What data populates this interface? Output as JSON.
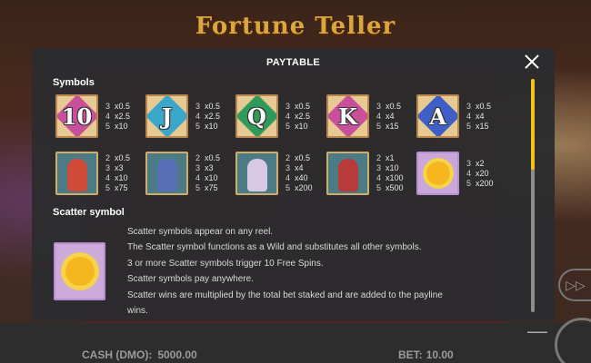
{
  "game": {
    "title": "Fortune Teller",
    "cash_label": "CASH (DMO):",
    "cash_value": "5000.00",
    "bet_label": "BET:",
    "bet_value": "10.00"
  },
  "paytable": {
    "title": "PAYTABLE",
    "close_icon": "close-icon",
    "symbols_heading": "Symbols",
    "symbols": [
      {
        "label": "10",
        "kind": "card",
        "color": "#c8509a",
        "pays": [
          [
            "3",
            "x0.5"
          ],
          [
            "4",
            "x2.5"
          ],
          [
            "5",
            "x10"
          ]
        ]
      },
      {
        "label": "J",
        "kind": "card",
        "color": "#3aa6c9",
        "pays": [
          [
            "3",
            "x0.5"
          ],
          [
            "4",
            "x2.5"
          ],
          [
            "5",
            "x10"
          ]
        ]
      },
      {
        "label": "Q",
        "kind": "card",
        "color": "#2f9a5a",
        "pays": [
          [
            "3",
            "x0.5"
          ],
          [
            "4",
            "x2.5"
          ],
          [
            "5",
            "x10"
          ]
        ]
      },
      {
        "label": "K",
        "kind": "card",
        "color": "#c8509a",
        "pays": [
          [
            "3",
            "x0.5"
          ],
          [
            "4",
            "x4"
          ],
          [
            "5",
            "x15"
          ]
        ]
      },
      {
        "label": "A",
        "kind": "card",
        "color": "#3f5fc7",
        "pays": [
          [
            "3",
            "x0.5"
          ],
          [
            "4",
            "x4"
          ],
          [
            "5",
            "x15"
          ]
        ]
      },
      {
        "label": "",
        "kind": "jester",
        "color": "#d04a3a",
        "pays": [
          [
            "2",
            "x0.5"
          ],
          [
            "3",
            "x3"
          ],
          [
            "4",
            "x10"
          ],
          [
            "5",
            "x75"
          ]
        ]
      },
      {
        "label": "",
        "kind": "knight",
        "color": "#5a6fb8",
        "pays": [
          [
            "2",
            "x0.5"
          ],
          [
            "3",
            "x3"
          ],
          [
            "4",
            "x10"
          ],
          [
            "5",
            "x75"
          ]
        ]
      },
      {
        "label": "",
        "kind": "queen",
        "color": "#d9c7e6",
        "pays": [
          [
            "2",
            "x0.5"
          ],
          [
            "3",
            "x4"
          ],
          [
            "4",
            "x40"
          ],
          [
            "5",
            "x200"
          ]
        ]
      },
      {
        "label": "",
        "kind": "fortune-teller",
        "color": "#b83a3a",
        "pays": [
          [
            "2",
            "x1"
          ],
          [
            "3",
            "x10"
          ],
          [
            "4",
            "x100"
          ],
          [
            "5",
            "x500"
          ]
        ]
      },
      {
        "label": "",
        "kind": "sun-scatter",
        "color": "#f6b71e",
        "pays": [
          [
            "3",
            "x2"
          ],
          [
            "4",
            "x20"
          ],
          [
            "5",
            "x200"
          ]
        ]
      }
    ],
    "scatter_heading": "Scatter symbol",
    "scatter_lines": [
      "Scatter symbols appear on any reel.",
      "The Scatter symbol functions as a Wild and substitutes all other symbols.",
      "3 or more Scatter symbols trigger 10 Free Spins.",
      "Scatter symbols pay anywhere.",
      "Scatter wins are multiplied by the total bet staked and are added to the payline",
      "wins."
    ]
  },
  "colors": {
    "accent": "#f4c317",
    "modal_bg": "#2c2c2e",
    "title_gold": "#d9a640"
  }
}
